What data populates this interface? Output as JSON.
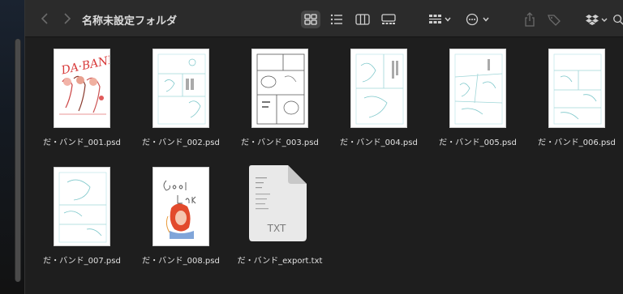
{
  "window": {
    "title": "名称未設定フォルダ"
  },
  "toolbar": {
    "back_icon": "chevron-left-icon",
    "forward_icon": "chevron-right-icon",
    "view_icons": [
      "grid-view-icon",
      "list-view-icon",
      "column-view-icon",
      "gallery-view-icon"
    ],
    "active_view": "grid-view-icon",
    "group_icon": "group-by-icon",
    "more_icon": "ellipsis-circle-icon",
    "share_icon": "share-icon",
    "tag_icon": "tag-icon",
    "dropbox_icon": "dropbox-icon",
    "search_icon": "search-icon"
  },
  "files": [
    {
      "name": "だ・バンド_001.psd",
      "kind": "psd",
      "thumb": "color-cover"
    },
    {
      "name": "だ・バンド_002.psd",
      "kind": "psd",
      "thumb": "sketch"
    },
    {
      "name": "だ・バンド_003.psd",
      "kind": "psd",
      "thumb": "ink-panels"
    },
    {
      "name": "だ・バンド_004.psd",
      "kind": "psd",
      "thumb": "sketch"
    },
    {
      "name": "だ・バンド_005.psd",
      "kind": "psd",
      "thumb": "sketch"
    },
    {
      "name": "だ・バンド_006.psd",
      "kind": "psd",
      "thumb": "sketch"
    },
    {
      "name": "だ・バンド_007.psd",
      "kind": "psd",
      "thumb": "sketch"
    },
    {
      "name": "だ・バンド_008.psd",
      "kind": "psd",
      "thumb": "good-luck"
    },
    {
      "name": "だ・バンド_export.txt",
      "kind": "txt",
      "thumb": "txt",
      "badge": "TXT"
    }
  ]
}
